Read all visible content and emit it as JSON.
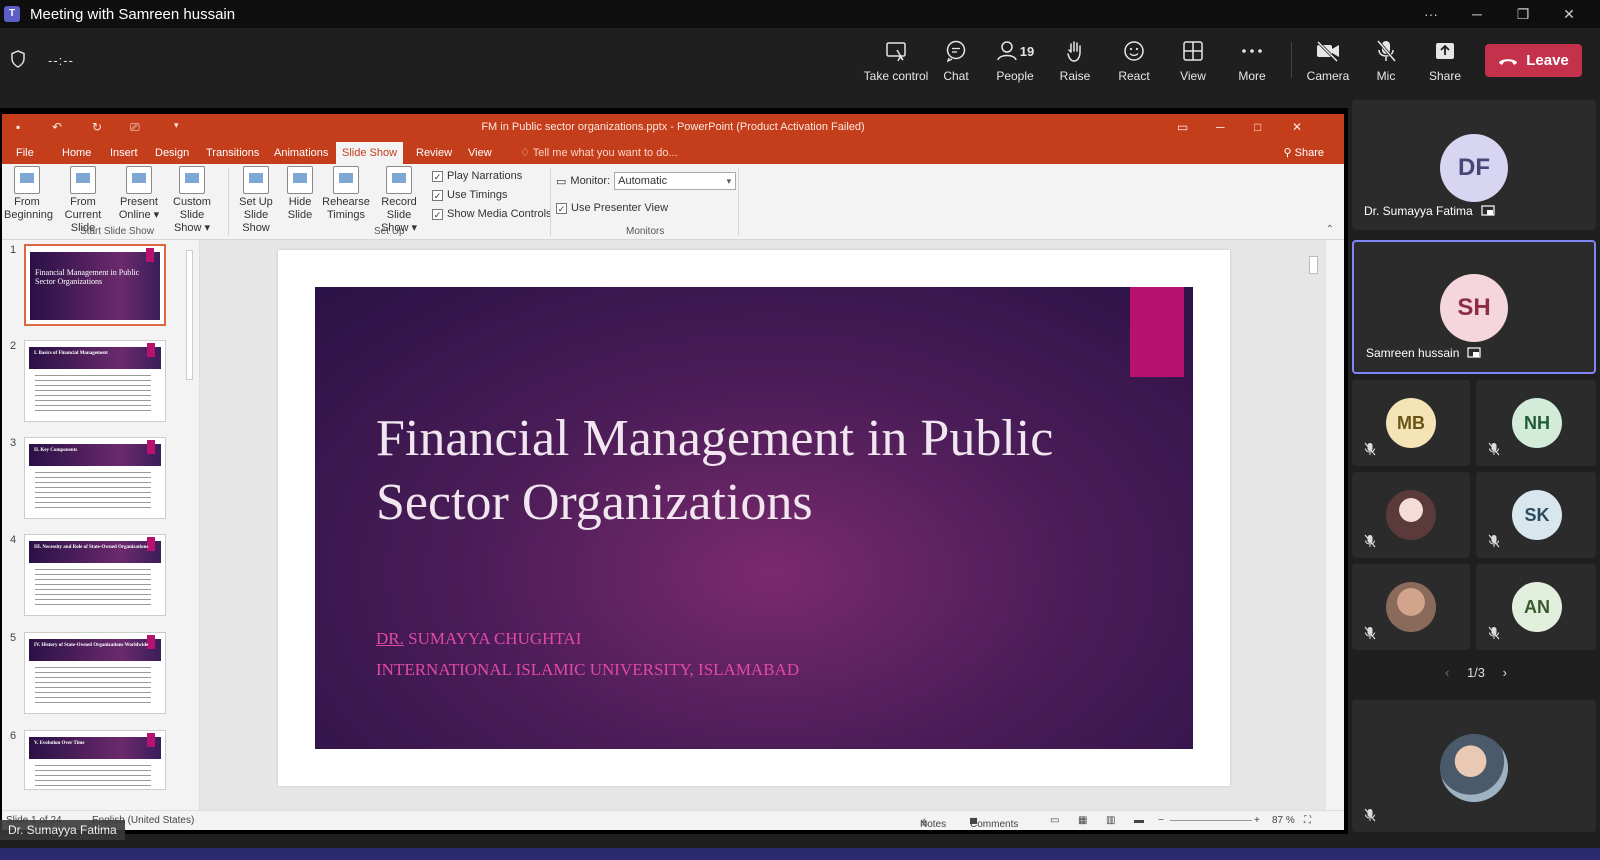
{
  "window": {
    "app_icon": "T",
    "title": "Meeting with Samreen hussain",
    "controls": [
      "···",
      "─",
      "❐",
      "✕"
    ]
  },
  "toolbar": {
    "timer": "--:--",
    "buttons": [
      {
        "label": "Take control",
        "icon": "take-control-icon"
      },
      {
        "label": "Chat",
        "icon": "chat-icon"
      },
      {
        "label": "People",
        "icon": "people-icon",
        "count": "19"
      },
      {
        "label": "Raise",
        "icon": "raise-hand-icon"
      },
      {
        "label": "React",
        "icon": "react-icon"
      },
      {
        "label": "View",
        "icon": "view-icon"
      },
      {
        "label": "More",
        "icon": "more-icon"
      },
      {
        "label": "Camera",
        "icon": "camera-off-icon"
      },
      {
        "label": "Mic",
        "icon": "mic-off-icon"
      },
      {
        "label": "Share",
        "icon": "share-icon"
      }
    ],
    "leave_label": "Leave"
  },
  "powerpoint": {
    "doc_title": "FM in Public sector organizations.pptx - PowerPoint (Product Activation Failed)",
    "tabs": [
      "File",
      "Home",
      "Insert",
      "Design",
      "Transitions",
      "Animations",
      "Slide Show",
      "Review",
      "View"
    ],
    "active_tab": "Slide Show",
    "tell_me": "Tell me what you want to do...",
    "share": "Share",
    "ribbon": {
      "start_buttons": [
        {
          "l1": "From",
          "l2": "Beginning"
        },
        {
          "l1": "From",
          "l2": "Current Slide"
        },
        {
          "l1": "Present",
          "l2": "Online ▾"
        },
        {
          "l1": "Custom Slide",
          "l2": "Show ▾"
        }
      ],
      "start_group": "Start Slide Show",
      "setup_buttons": [
        {
          "l1": "Set Up",
          "l2": "Slide Show"
        },
        {
          "l1": "Hide",
          "l2": "Slide"
        },
        {
          "l1": "Rehearse",
          "l2": "Timings"
        },
        {
          "l1": "Record Slide",
          "l2": "Show ▾"
        }
      ],
      "setup_checks": [
        "Play Narrations",
        "Use Timings",
        "Show Media Controls"
      ],
      "setup_group": "Set Up",
      "monitor_label": "Monitor:",
      "monitor_value": "Automatic",
      "presenter_view": "Use Presenter View",
      "monitors_group": "Monitors"
    },
    "thumbnails": [
      {
        "num": "1",
        "title": "Financial Management in Public Sector Organizations"
      },
      {
        "num": "2",
        "title": "I. Basics of Financial Management"
      },
      {
        "num": "3",
        "title": "II. Key Components"
      },
      {
        "num": "4",
        "title": "III. Necessity and Role of State-Owned Organizations"
      },
      {
        "num": "5",
        "title": "IV. History of State-Owned Organizations Worldwide"
      },
      {
        "num": "6",
        "title": "V. Evolution Over Time"
      }
    ],
    "slide": {
      "title": "Financial Management in Public Sector Organizations",
      "author_prefix": "DR.",
      "author_name": " SUMAYYA CHUGHTAI",
      "university": "INTERNATIONAL ISLAMIC UNIVERSITY, ISLAMABAD"
    },
    "status": {
      "slide_info": "Slide 1 of 24",
      "language": "English (United States)",
      "notes": "Notes",
      "comments": "Comments",
      "zoom": "87 %"
    }
  },
  "presenter_name": "Dr. Sumayya Fatima",
  "participants": [
    {
      "initials": "DF",
      "name": "Dr. Sumayya Fatima",
      "color": "#d7d5f2"
    },
    {
      "initials": "SH",
      "name": "Samreen hussain",
      "color": "#f6d6dd"
    },
    {
      "initials": "MB",
      "color": "#f4e3b5"
    },
    {
      "initials": "NH",
      "color": "#d3ecd9"
    },
    {
      "initials": "",
      "color": "#d9c2c7"
    },
    {
      "initials": "SK",
      "color": "#d8e6ee"
    },
    {
      "initials": "",
      "color": "#c9a38e"
    },
    {
      "initials": "AN",
      "color": "#e3efdd"
    },
    {
      "initials": "",
      "color": "#6f8aa6"
    }
  ],
  "pager": "1/3"
}
